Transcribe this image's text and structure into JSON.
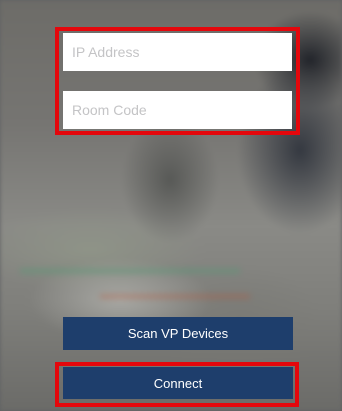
{
  "form": {
    "ip_address_placeholder": "IP Address",
    "ip_address_value": "",
    "room_code_placeholder": "Room Code",
    "room_code_value": ""
  },
  "actions": {
    "scan_label": "Scan VP Devices",
    "connect_label": "Connect"
  },
  "colors": {
    "button_background": "#1e3e6c",
    "button_text": "#ffffff",
    "highlight_border": "#e4070c",
    "field_background": "#ffffff",
    "placeholder_text": "#c4c4c6"
  }
}
